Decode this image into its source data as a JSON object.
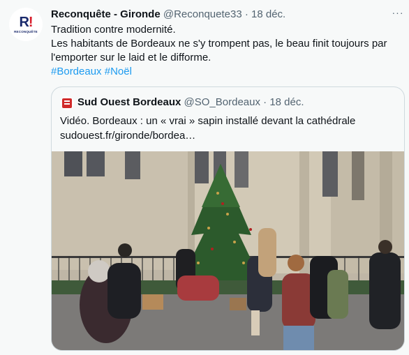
{
  "tweet": {
    "author_name": "Reconquête - Gironde",
    "author_handle": "@Reconquete33",
    "separator": "·",
    "date": "18 déc.",
    "more_label": "···",
    "avatar_logo": "R!",
    "avatar_sub": "RECONQUÊTE",
    "text_lines": [
      "Tradition contre modernité.",
      "Les habitants de Bordeaux ne s'y trompent pas, le beau finit toujours par",
      "l'emporter sur le laid et le difforme."
    ],
    "hashtags": "#Bordeaux #Noël"
  },
  "quote": {
    "author_name": "Sud Ouest Bordeaux",
    "author_handle": "@SO_Bordeaux",
    "separator": "·",
    "date": "18 déc.",
    "text_lines": [
      "Vidéo. Bordeaux : un « vrai » sapin installé devant la cathédrale",
      "sudouest.fr/gironde/bordea…"
    ]
  },
  "colors": {
    "background": "#f7f9f9",
    "text_primary": "#0f1419",
    "text_secondary": "#536471",
    "link": "#1d9bf0",
    "border": "#cfd9de"
  }
}
